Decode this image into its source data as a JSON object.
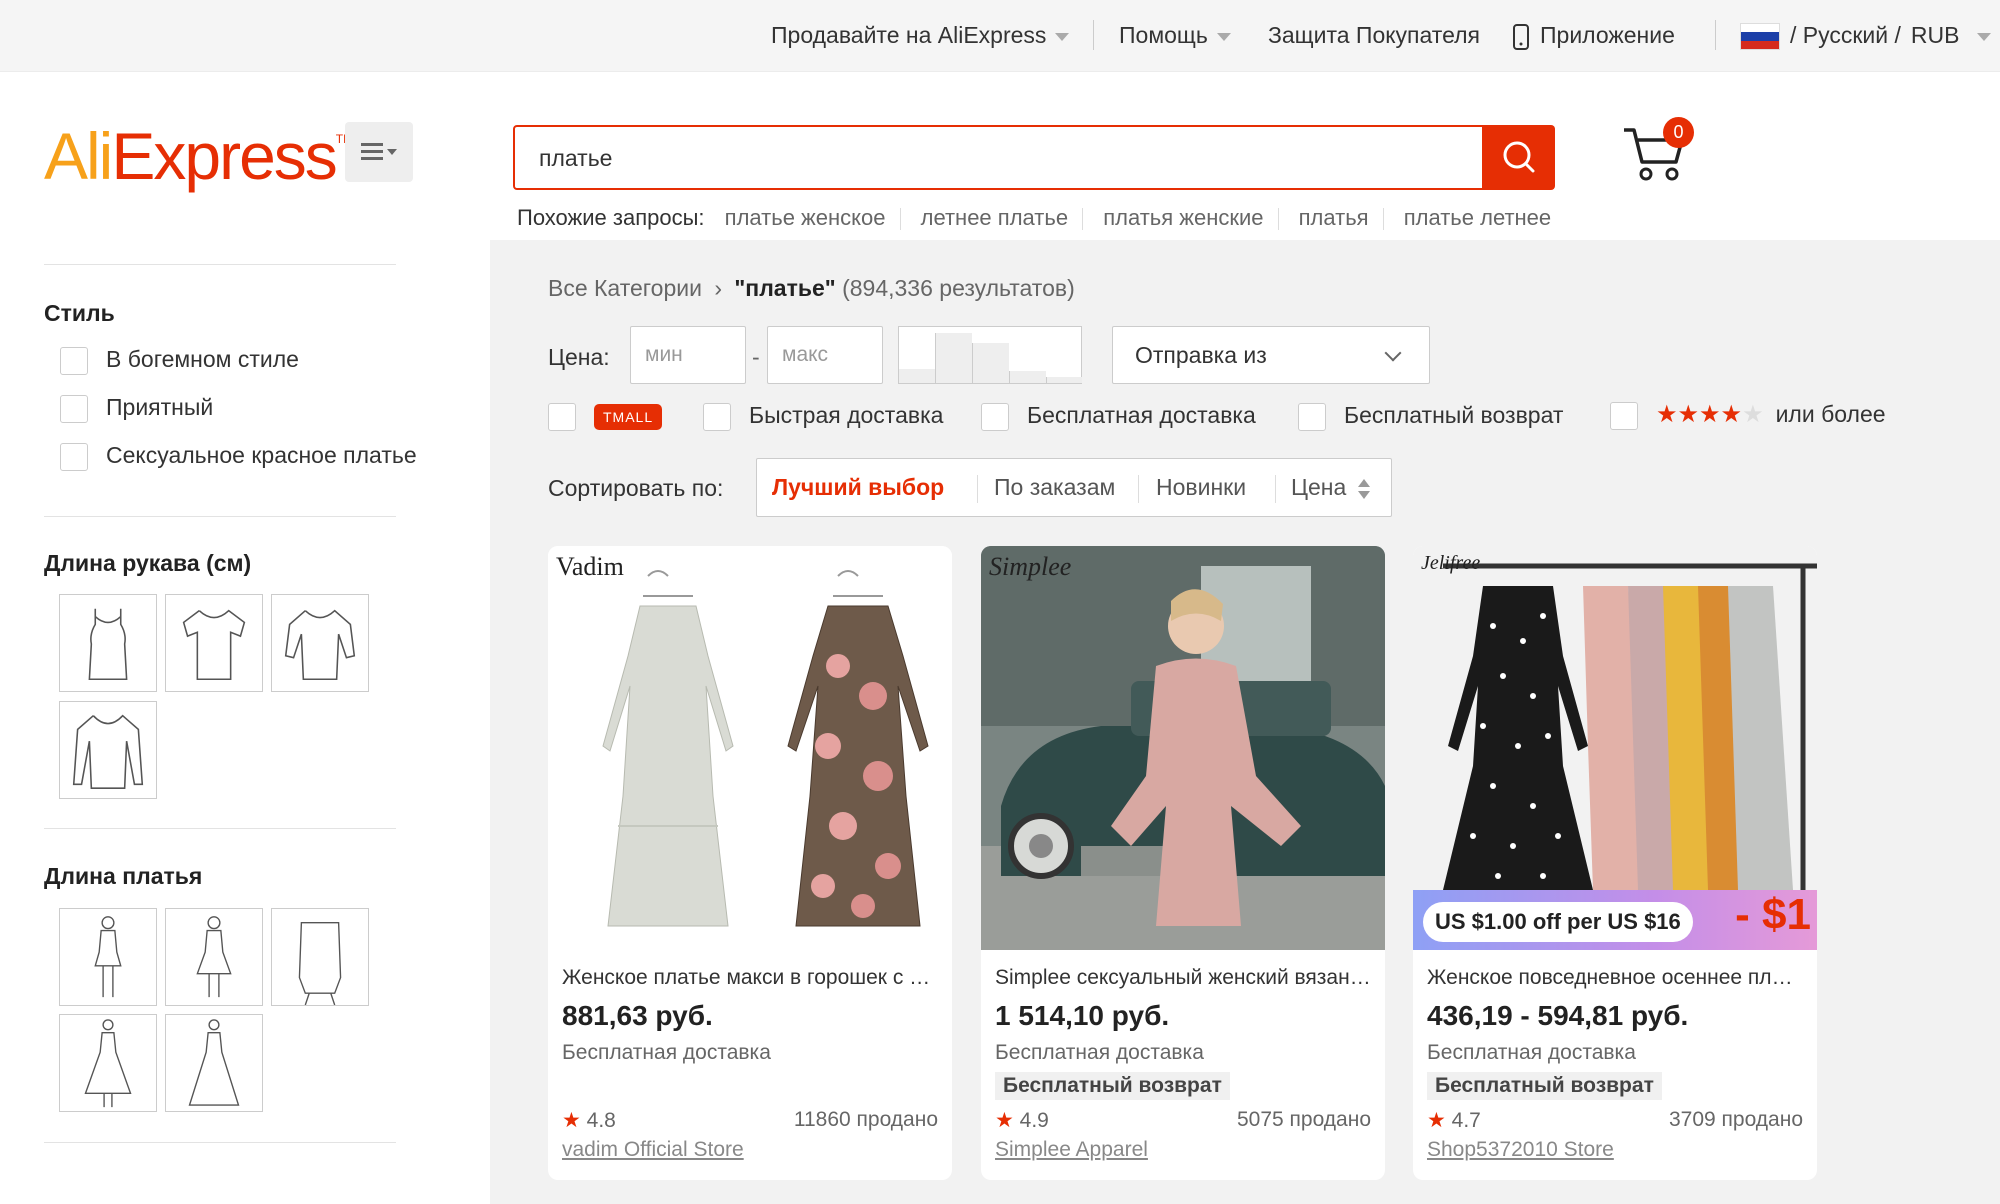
{
  "topbar": {
    "sell": "Продавайте на AliExpress",
    "help": "Помощь",
    "protection": "Защита Покупателя",
    "app": "Приложение",
    "locale": "/ Русский /",
    "currency": "RUB"
  },
  "logo": {
    "ali": "Ali",
    "express": "Express",
    "tm": "TM"
  },
  "search": {
    "value": "платье"
  },
  "related": {
    "label": "Похожие запросы:",
    "items": [
      "платье женское",
      "летнее платье",
      "платья женские",
      "платья",
      "платье летнее"
    ]
  },
  "cart": {
    "count": "0"
  },
  "sidebar": {
    "style_title": "Стиль",
    "style_options": [
      "В богемном стиле",
      "Приятный",
      "Сексуальное красное платье"
    ],
    "sleeve_title": "Длина рукава (см)",
    "dress_title": "Длина платья"
  },
  "breadcrumb": {
    "root": "Все Категории",
    "sep": "›",
    "query": "\"платье\"",
    "count": "(894,336 результатов)"
  },
  "filters": {
    "price_label": "Цена:",
    "min_placeholder": "мин",
    "dash": "-",
    "max_placeholder": "макс",
    "ship_from": "Отправка из",
    "tmall": "TMALL",
    "fast": "Быстрая доставка",
    "free_ship": "Бесплатная доставка",
    "free_return": "Бесплатный возврат",
    "rating_suffix": "или более"
  },
  "sort": {
    "label": "Сортировать по:",
    "best": "Лучший выбор",
    "orders": "По заказам",
    "new": "Новинки",
    "price": "Цена"
  },
  "products": [
    {
      "brand": "Vadim",
      "title": "Женское платье макси в горошек с цветочным принтом",
      "price": "881,63 руб.",
      "shipping": "Бесплатная доставка",
      "rating": "4.8",
      "sold": "11860 продано",
      "store": "vadim Official Store"
    },
    {
      "brand": "Simplee",
      "title": "Simplee сексуальный женский вязаный свитер платье",
      "price": "1 514,10 руб.",
      "shipping": "Бесплатная доставка",
      "returns": "Бесплатный возврат",
      "rating": "4.9",
      "sold": "5075 продано",
      "store": "Simplee Apparel"
    },
    {
      "brand": "Jelifree",
      "title": "Женское повседневное осеннее платье в горошек",
      "price": "436,19 - 594,81 руб.",
      "shipping": "Бесплатная доставка",
      "returns": "Бесплатный возврат",
      "promo": "US $1.00 off per US $16",
      "promo_big": "- $1",
      "rating": "4.7",
      "sold": "3709 продано",
      "store": "Shop5372010 Store"
    }
  ]
}
